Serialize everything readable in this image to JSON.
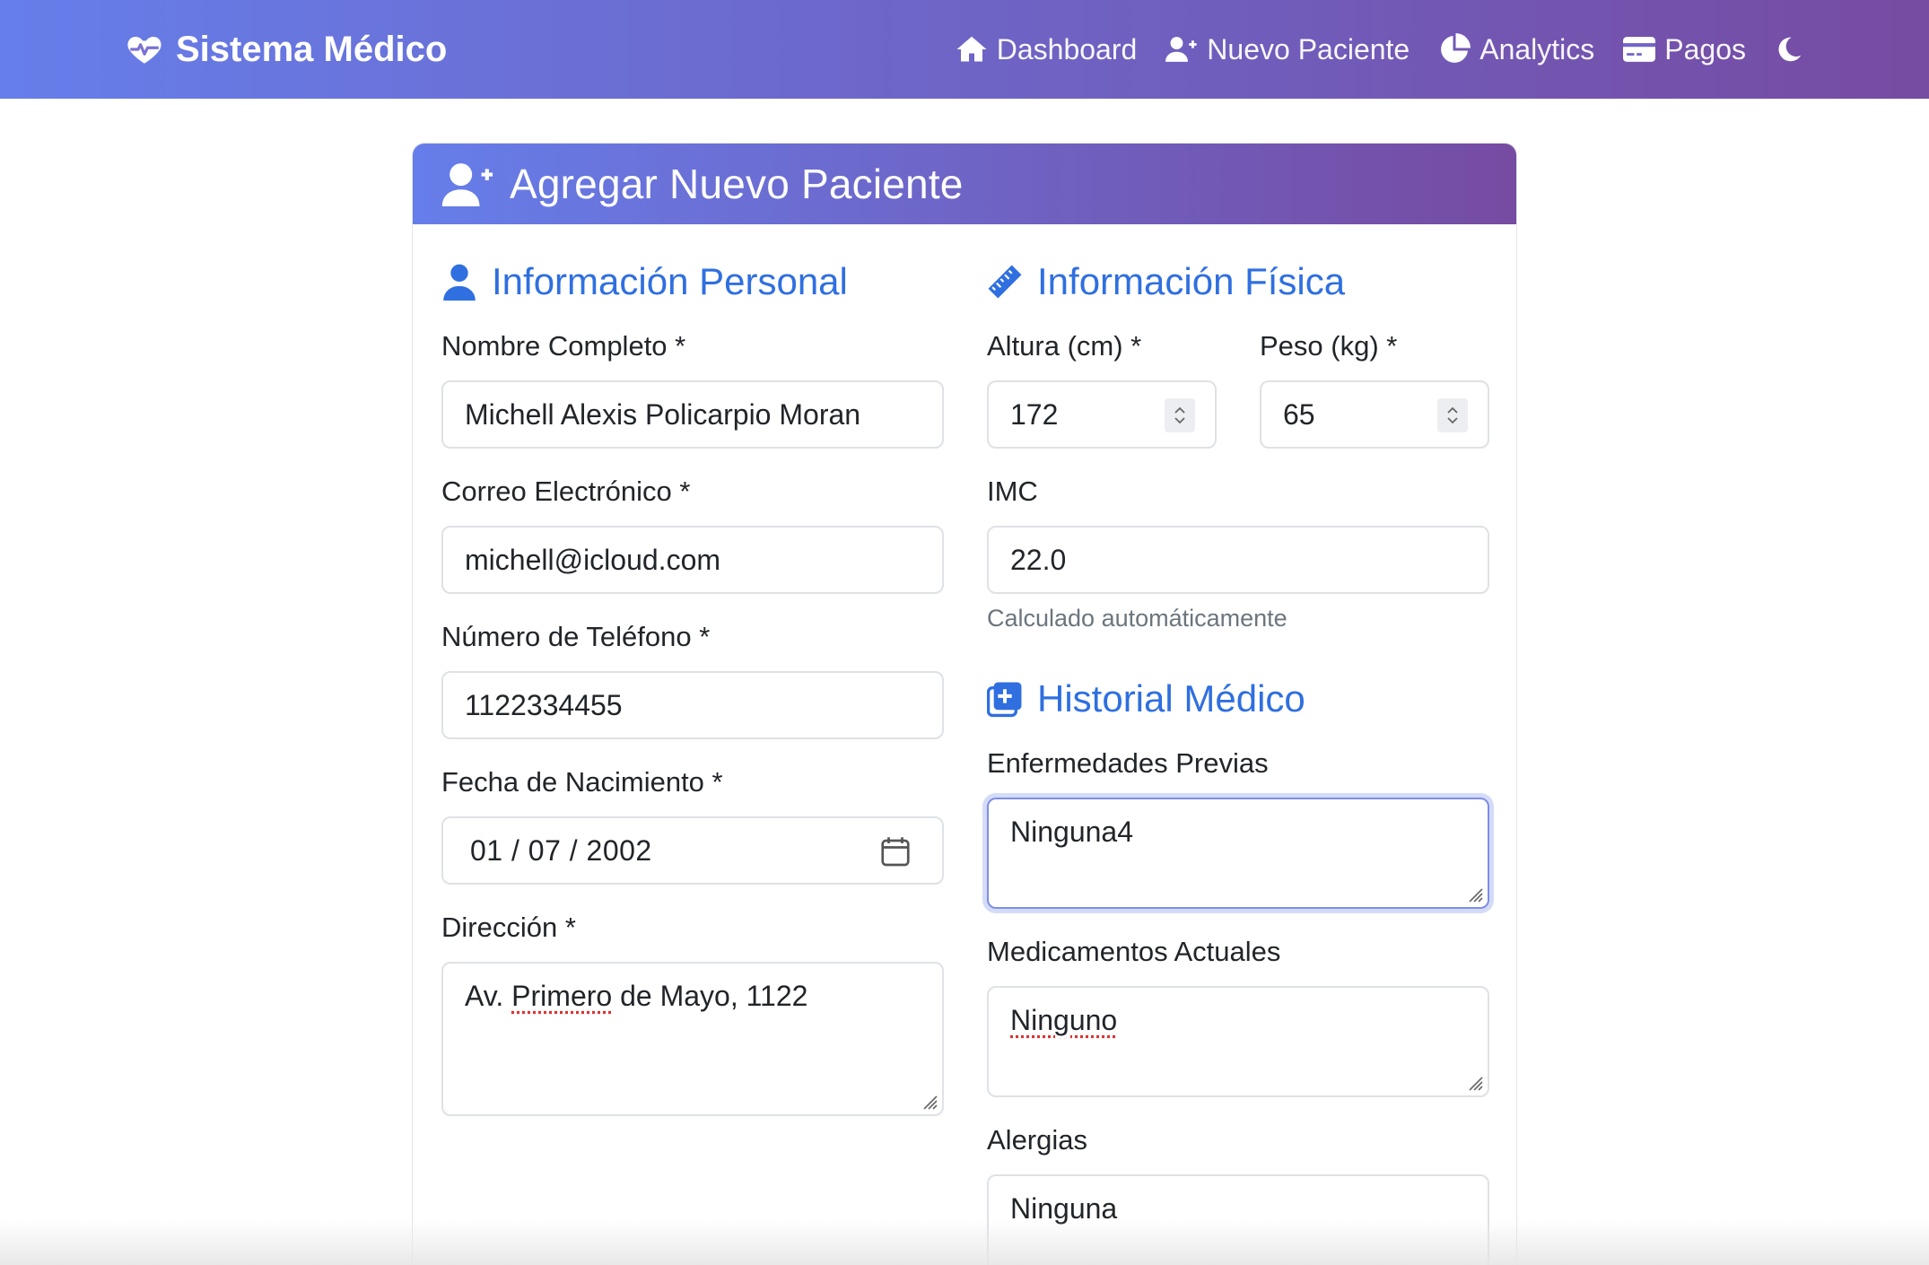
{
  "navbar": {
    "brand": "Sistema Médico",
    "links": [
      {
        "label": "Dashboard",
        "icon": "home-icon"
      },
      {
        "label": "Nuevo Paciente",
        "icon": "user-plus-icon"
      },
      {
        "label": "Analytics",
        "icon": "pie-chart-icon"
      },
      {
        "label": "Pagos",
        "icon": "credit-card-icon"
      }
    ],
    "theme_icon": "moon-icon"
  },
  "form": {
    "title": "Agregar Nuevo Paciente",
    "personal": {
      "section_title": "Información Personal",
      "name_label": "Nombre Completo *",
      "name_value": "Michell Alexis Policarpio Moran",
      "email_label": "Correo Electrónico *",
      "email_value": "michell@icloud.com",
      "phone_label": "Número de Teléfono *",
      "phone_value": "1122334455",
      "birth_label": "Fecha de Nacimiento *",
      "birth_value": "01 / 07 / 2002",
      "address_label": "Dirección *",
      "address_value_prefix": "Av. ",
      "address_value_spell": "Primero",
      "address_value_suffix": " de Mayo, 1122"
    },
    "physical": {
      "section_title": "Información Física",
      "height_label": "Altura (cm) *",
      "height_value": "172",
      "weight_label": "Peso (kg) *",
      "weight_value": "65",
      "bmi_label": "IMC",
      "bmi_value": "22.0",
      "bmi_help": "Calculado automáticamente"
    },
    "history": {
      "section_title": "Historial Médico",
      "diseases_label": "Enfermedades Previas",
      "diseases_value": "Ninguna4",
      "medications_label": "Medicamentos Actuales",
      "medications_value": "Ninguno",
      "allergies_label": "Alergias",
      "allergies_value": "Ninguna"
    }
  },
  "colors": {
    "gradient_start": "#667eea",
    "gradient_end": "#764ba2",
    "section_title": "#2f6fe0"
  }
}
